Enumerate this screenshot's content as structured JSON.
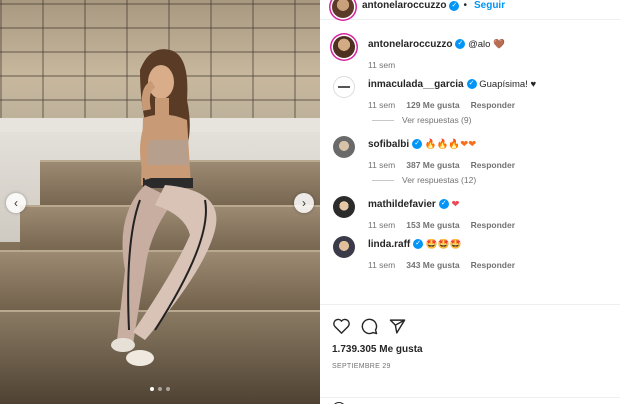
{
  "post": {
    "author": "antonelaroccuzzo",
    "follow_label": "Seguir",
    "separator": "•"
  },
  "caption": {
    "username": "antonelaroccuzzo",
    "text": "@alo",
    "emoji": "🤎",
    "time": "11 sem"
  },
  "comments": [
    {
      "username": "inmaculada__garcia",
      "verified": true,
      "text": "Guapísima! ♥",
      "time": "11 sem",
      "likes": "129 Me gusta",
      "reply": "Responder",
      "replies": "Ver respuestas (9)"
    },
    {
      "username": "sofibalbi",
      "verified": true,
      "text": "🔥🔥🔥❤❤",
      "time": "11 sem",
      "likes": "387 Me gusta",
      "reply": "Responder",
      "replies": "Ver respuestas (12)"
    },
    {
      "username": "mathildefavier",
      "verified": true,
      "text": "❤",
      "time": "11 sem",
      "likes": "153 Me gusta",
      "reply": "Responder"
    },
    {
      "username": "linda.raff",
      "verified": true,
      "text": "🤩🤩🤩",
      "time": "11 sem",
      "likes": "343 Me gusta",
      "reply": "Responder"
    }
  ],
  "actions": {
    "like_icon": "heart-icon",
    "comment_icon": "comment-icon",
    "share_icon": "share-icon"
  },
  "likes_count": "1.739.305 Me gusta",
  "date": "SEPTIEMBRE 29",
  "carousel": {
    "prev_icon": "chevron-left-icon",
    "next_icon": "chevron-right-icon",
    "dots": 3,
    "active_dot": 1
  },
  "colors": {
    "accent": "#0095f6",
    "heart": "#ed4956",
    "text": "#262626",
    "muted": "#737373"
  }
}
